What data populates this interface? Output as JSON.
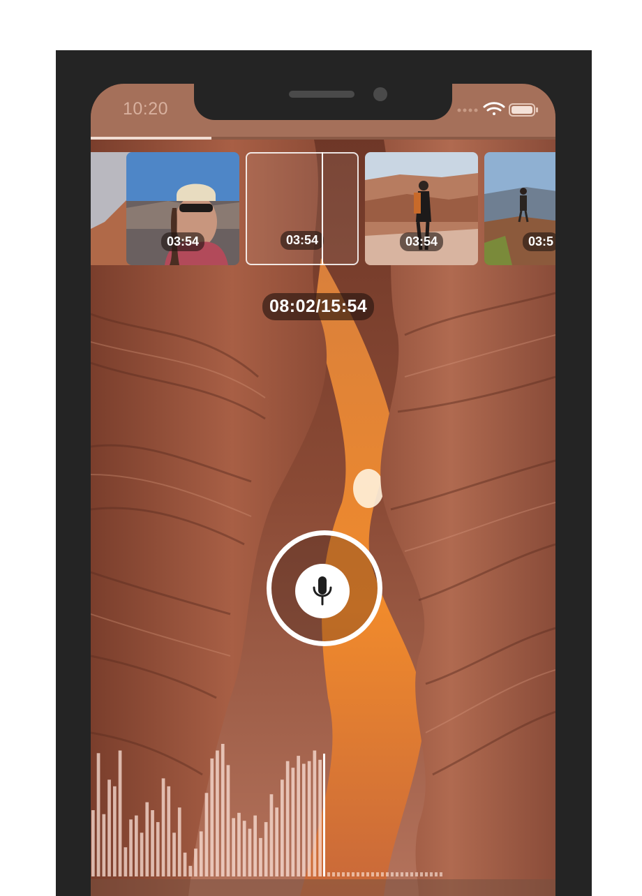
{
  "status_bar": {
    "time": "10:20",
    "icons": [
      "signal-dots-icon",
      "wifi-icon",
      "battery-icon"
    ]
  },
  "playback": {
    "progress": 0.26,
    "timecode": "08:02/15:54",
    "played_fraction_waveform": 0.5
  },
  "clips": [
    {
      "duration": ""
    },
    {
      "duration": "03:54"
    },
    {
      "duration": "03:54"
    },
    {
      "duration": "03:54"
    },
    {
      "duration": "03:5"
    }
  ],
  "record": {
    "icon": "microphone-icon"
  },
  "colors": {
    "status_bar_bg": "#a5705a",
    "device_frame": "#242424",
    "accent_white": "#ffffff"
  },
  "waveform_levels": [
    0.5,
    0.93,
    0.47,
    0.73,
    0.68,
    0.95,
    0.22,
    0.43,
    0.46,
    0.33,
    0.56,
    0.5,
    0.41,
    0.74,
    0.68,
    0.33,
    0.52,
    0.18,
    0.08,
    0.21,
    0.34,
    0.63,
    0.89,
    0.95,
    1.0,
    0.84,
    0.44,
    0.48,
    0.42,
    0.36,
    0.46,
    0.29,
    0.41,
    0.62,
    0.52,
    0.73,
    0.87,
    0.82,
    0.91,
    0.85,
    0.87,
    0.95,
    0.88
  ]
}
